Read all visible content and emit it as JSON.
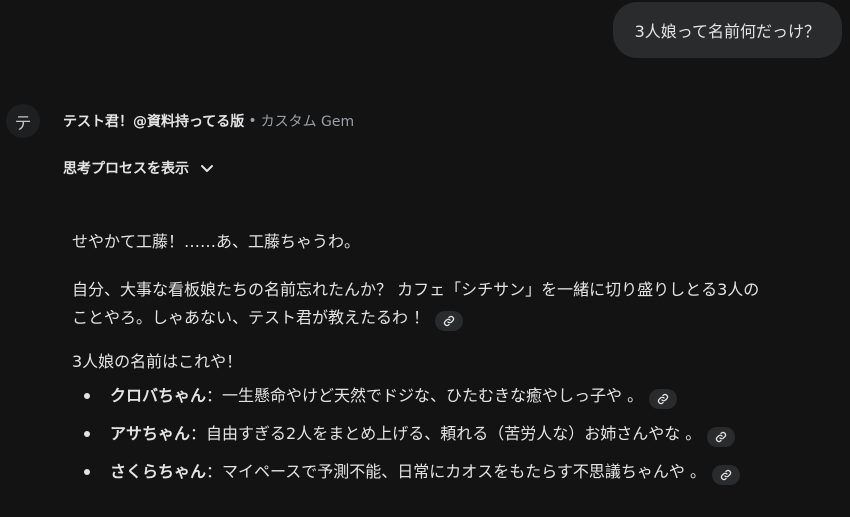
{
  "user_message": "3人娘って名前何だっけ？",
  "gem": {
    "avatar_letter": "テ",
    "name": "テスト君！@資料持ってる版",
    "separator": "•",
    "type_label": "カスタム Gem"
  },
  "thinking": {
    "label": "思考プロセスを表示",
    "icon": "chevron-down-icon"
  },
  "response": {
    "p1": "せやかて工藤！……あ、工藤ちゃうわ。",
    "p2_line1": "自分、大事な看板娘たちの名前忘れたんか？ カフェ「シチサン」を一緒に切り盛りしとる3人の",
    "p2_line2": "ことやろ。しゃあない、テスト君が教えたるわ ！",
    "p3": "3人娘の名前はこれや！",
    "items": [
      {
        "name": "クロバちゃん",
        "desc": "：一生懸命やけど天然でドジな、ひたむきな癒やしっ子や 。"
      },
      {
        "name": "アサちゃん",
        "desc": "：自由すぎる2人をまとめ上げる、頼れる（苦労人な）お姉さんやな 。"
      },
      {
        "name": "さくらちゃん",
        "desc": "：マイペースで予測不能、日常にカオスをもたらす不思議ちゃんや 。"
      }
    ]
  },
  "icons": {
    "citation": "link-icon"
  },
  "colors": {
    "background": "#131314",
    "bubble": "#2a2b2d",
    "text": "#e3e3e3",
    "muted": "#9aa0a6"
  }
}
